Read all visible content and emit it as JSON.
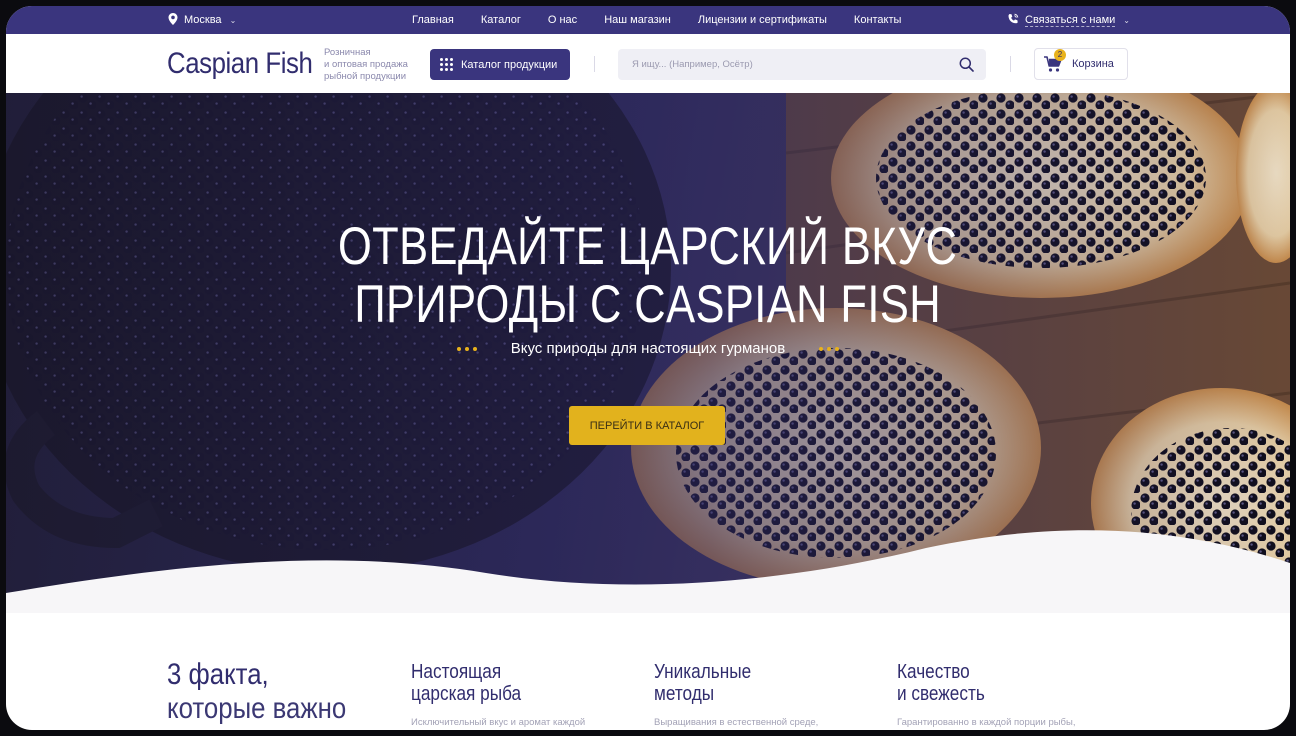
{
  "topbar": {
    "city": "Москва",
    "nav": [
      "Главная",
      "Каталог",
      "О нас",
      "Наш магазин",
      "Лицензии и сертификаты",
      "Контакты"
    ],
    "contact": "Связаться с нами"
  },
  "header": {
    "logo": "Caspian Fish",
    "tagline": [
      "Розничная",
      "и оптовая продажа",
      "рыбной продукции"
    ],
    "catalog_button": "Каталог продукции",
    "search_placeholder": "Я ищу... (Например, Осётр)",
    "cart_label": "Корзина",
    "cart_count": "2"
  },
  "hero": {
    "title_line1": "Отведайте царский вкус",
    "title_line2": "природы с Caspian Fish",
    "subtitle": "Вкус природы для настоящих гурманов",
    "button": "Перейти в каталог"
  },
  "facts": {
    "title_line1": "3 факта,",
    "title_line2": "которые важно",
    "items": [
      {
        "title1": "Настоящая",
        "title2": "царская рыба",
        "text": "Исключительный вкус и аромат каждой порции"
      },
      {
        "title1": "Уникальные",
        "title2": "методы",
        "text": "Выращивания в естественной среде, что придаёт вашей продукции"
      },
      {
        "title1": "Качество",
        "title2": "и свежесть",
        "text": "Гарантированно в каждой порции рыбы, поставляемой вам напрямую до дверь"
      }
    ]
  },
  "colors": {
    "brand": "#3a357e",
    "accent": "#e2b21d"
  }
}
